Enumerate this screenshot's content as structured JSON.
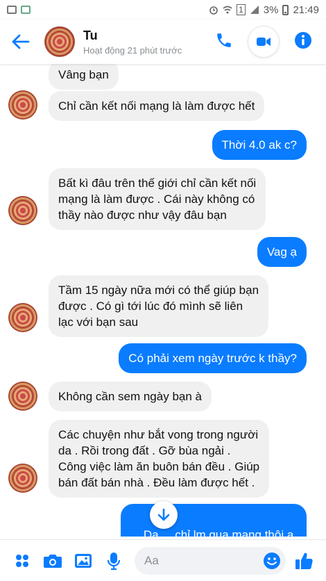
{
  "status_bar": {
    "battery": "3%",
    "time": "21:49",
    "sim": "1"
  },
  "header": {
    "name": "Tu",
    "active_status": "Hoạt động 21 phút trước",
    "icons": [
      "back-arrow-icon",
      "phone-icon",
      "video-camera-icon",
      "info-icon"
    ]
  },
  "messages": [
    {
      "dir": "in",
      "text": "Vâng bạn"
    },
    {
      "dir": "in",
      "text": "Chỉ cần kết nối mạng là làm được hết"
    },
    {
      "dir": "out",
      "text": "Thời 4.0 ak c?"
    },
    {
      "dir": "in",
      "lines": [
        "Bất kì đâu trên thế giới chỉ cần kết nối",
        "mạng là làm được . Cái này không có",
        "thầy nào được như vậy đâu bạn"
      ]
    },
    {
      "dir": "out",
      "text": "Vag ạ"
    },
    {
      "dir": "in",
      "lines": [
        "Tầm 15 ngày nữa mới có thể giúp bạn",
        "được . Có gì tới lúc đó mình sẽ liên",
        "lạc với bạn sau"
      ]
    },
    {
      "dir": "out",
      "text": "Có phải xem ngày trước k thầy?"
    },
    {
      "dir": "in",
      "text": "Không cần sem ngày bạn à"
    },
    {
      "dir": "in",
      "lines": [
        "Các chuyện như bắt vong trong người",
        "da . Rồi trong đất . Gỡ bùa ngải .",
        "Công việc làm ăn buôn bán đều . Giúp",
        "bán đất bán nhà . Đều làm được hết ."
      ]
    },
    {
      "dir": "out",
      "text": "Dạ     chỉ lm qua mạng thôi ạ."
    }
  ],
  "composer": {
    "placeholder": "Aa",
    "icons": [
      "menu-dots-icon",
      "camera-icon",
      "gallery-icon",
      "microphone-icon",
      "emoji-icon",
      "like-icon"
    ]
  },
  "colors": {
    "accent": "#0a7cff",
    "incoming_bubble": "#f1f0f0"
  }
}
